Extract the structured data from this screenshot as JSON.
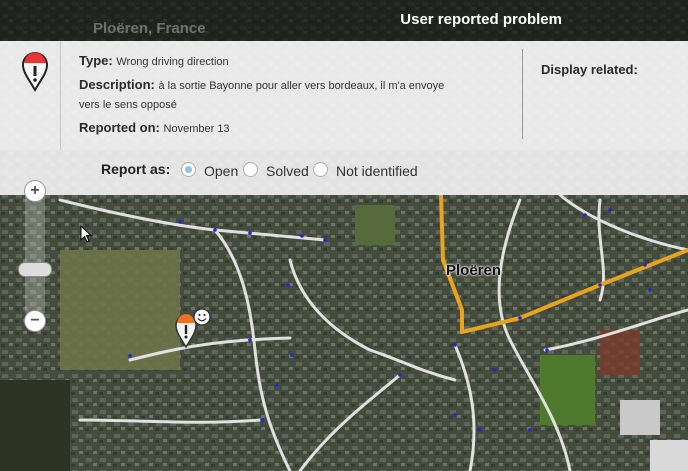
{
  "map": {
    "location": "Ploëren, France",
    "town_label": "Ploëren"
  },
  "panel": {
    "title": "User reported problem",
    "type_label": "Type:",
    "type_value": "Wrong driving direction",
    "description_label": "Description:",
    "description_line1": "à la sortie Bayonne pour aller vers bordeaux, il m'a envoye",
    "description_line2": "vers le sens opposé",
    "reported_label": "Reported on:",
    "reported_value": "November 13",
    "display_related": "Display related:"
  },
  "report": {
    "label": "Report as:",
    "options": [
      "Open",
      "Solved",
      "Not identified"
    ],
    "selected": "Open"
  },
  "zoom": {
    "in": "+",
    "out": "−"
  },
  "colors": {
    "main_road": "#e8a31f",
    "road": "#e8e8e8",
    "node": "#2222dd"
  },
  "icons": [
    "problem-marker-icon",
    "smiley-icon",
    "cursor-icon",
    "zoom-in-icon",
    "zoom-out-icon"
  ]
}
